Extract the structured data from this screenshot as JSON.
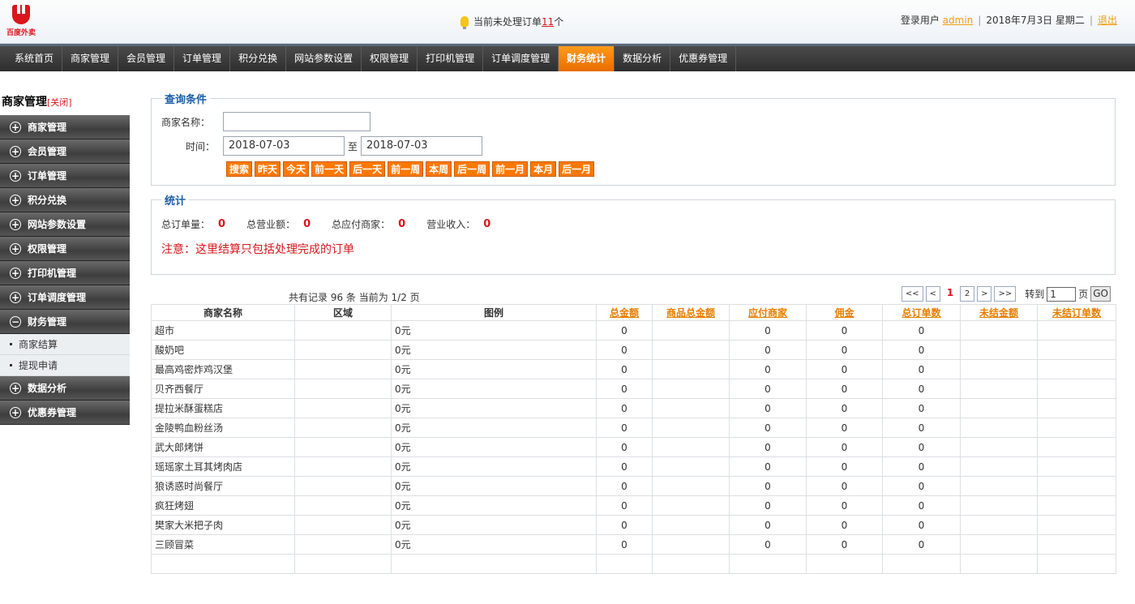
{
  "header": {
    "logo_text": "百度外卖",
    "notice_prefix": "当前未处理订单",
    "notice_count": "11",
    "notice_suffix": "个",
    "user_label": "登录用户",
    "user_name": "admin",
    "date": "2018年7月3日 星期二",
    "logout": "退出"
  },
  "nav": {
    "items": [
      "系统首页",
      "商家管理",
      "会员管理",
      "订单管理",
      "积分兑换",
      "网站参数设置",
      "权限管理",
      "打印机管理",
      "订单调度管理",
      "财务统计",
      "数据分析",
      "优惠券管理"
    ],
    "active_index": 9
  },
  "sidebar": {
    "title": "商家管理",
    "close": "[关闭]",
    "groups": [
      "商家管理",
      "会员管理",
      "订单管理",
      "积分兑换",
      "网站参数设置",
      "权限管理",
      "打印机管理",
      "订单调度管理",
      "财务管理"
    ],
    "finance_subs": [
      "商家结算",
      "提现申请"
    ],
    "groups_after": [
      "数据分析",
      "优惠券管理"
    ]
  },
  "query": {
    "legend": "查询条件",
    "merchant_label": "商家名称：",
    "merchant_value": "",
    "time_label": "时间：",
    "date_from": "2018-07-03",
    "to": "至",
    "date_to": "2018-07-03",
    "buttons": [
      "搜索",
      "昨天",
      "今天",
      "前一天",
      "后一天",
      "前一周",
      "本周",
      "后一周",
      "前一月",
      "本月",
      "后一月"
    ]
  },
  "stats": {
    "legend": "统计",
    "total_orders_label": "总订单量：",
    "total_orders": "0",
    "total_revenue_label": "总营业额：",
    "total_revenue": "0",
    "total_payable_label": "总应付商家：",
    "total_payable": "0",
    "income_label": "营业收入：",
    "income": "0",
    "note": "注意：这里结算只包括处理完成的订单"
  },
  "pager": {
    "record_info": "共有记录 96 条 当前为 1/2 页",
    "first": "<<",
    "prev": "<",
    "current": "1",
    "page2": "2",
    "next": ">",
    "last": ">>",
    "jump_label": "转到",
    "jump_value": "1",
    "page_unit": "页",
    "go": "GO"
  },
  "table": {
    "headers": [
      "商家名称",
      "区域",
      "图例",
      "总金额",
      "商品总金额",
      "应付商家",
      "佣金",
      "总订单数",
      "未结金额",
      "未结订单数"
    ],
    "rows": [
      [
        "超市",
        "",
        "0元",
        "0",
        "",
        "0",
        "0",
        "0",
        "",
        ""
      ],
      [
        "酸奶吧",
        "",
        "0元",
        "0",
        "",
        "0",
        "0",
        "0",
        "",
        ""
      ],
      [
        "最高鸡密炸鸡汉堡",
        "",
        "0元",
        "0",
        "",
        "0",
        "0",
        "0",
        "",
        ""
      ],
      [
        "贝齐西餐厅",
        "",
        "0元",
        "0",
        "",
        "0",
        "0",
        "0",
        "",
        ""
      ],
      [
        "提拉米酥蛋糕店",
        "",
        "0元",
        "0",
        "",
        "0",
        "0",
        "0",
        "",
        ""
      ],
      [
        "金陵鸭血粉丝汤",
        "",
        "0元",
        "0",
        "",
        "0",
        "0",
        "0",
        "",
        ""
      ],
      [
        "武大郎烤饼",
        "",
        "0元",
        "0",
        "",
        "0",
        "0",
        "0",
        "",
        ""
      ],
      [
        "瑶瑶家土耳其烤肉店",
        "",
        "0元",
        "0",
        "",
        "0",
        "0",
        "0",
        "",
        ""
      ],
      [
        "狼诱惑时尚餐厅",
        "",
        "0元",
        "0",
        "",
        "0",
        "0",
        "0",
        "",
        ""
      ],
      [
        "疯狂烤翅",
        "",
        "0元",
        "0",
        "",
        "0",
        "0",
        "0",
        "",
        ""
      ],
      [
        "樊家大米把子肉",
        "",
        "0元",
        "0",
        "",
        "0",
        "0",
        "0",
        "",
        ""
      ],
      [
        "三顾冒菜",
        "",
        "0元",
        "0",
        "",
        "0",
        "0",
        "0",
        "",
        ""
      ],
      [
        "",
        "",
        "",
        "",
        "",
        "",
        "",
        "",
        "",
        ""
      ]
    ]
  }
}
